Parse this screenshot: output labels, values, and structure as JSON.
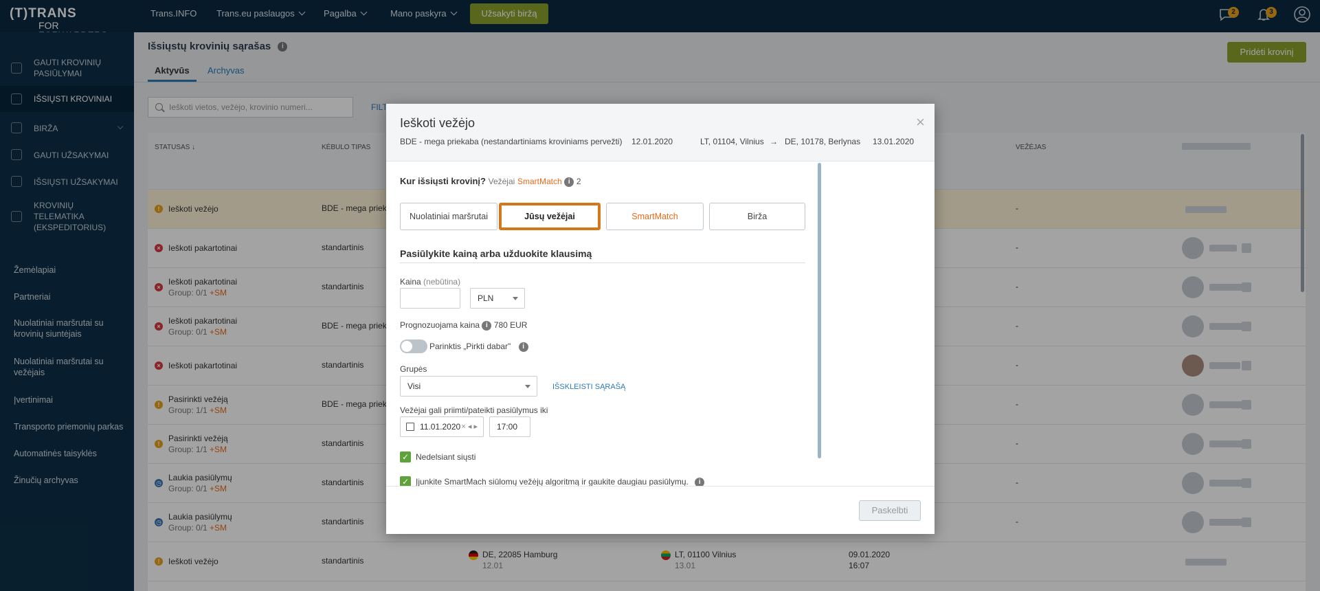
{
  "topbar": {
    "logo_line1": "(T)TRANS",
    "logo_line2": "FOR FORWARDERS",
    "nav": [
      {
        "label": "Trans.INFO"
      },
      {
        "label": "Trans.eu paslaugos"
      },
      {
        "label": "Pagalba"
      },
      {
        "label": "Mano paskyra"
      }
    ],
    "order_button": "Užsakyti biržą",
    "messages_badge": "2",
    "notifications_badge": "3"
  },
  "sidebar": {
    "main_items": [
      {
        "label": "GAUTI KROVINIŲ PASIŪLYMAI",
        "icon": "box-hand-icon"
      },
      {
        "label": "IŠSIŲSTI KROVINIAI",
        "icon": "dolly-icon"
      },
      {
        "label": "BIRŽA",
        "icon": "cube-icon"
      },
      {
        "label": "GAUTI UŽSAKYMAI",
        "icon": "grid-icon"
      },
      {
        "label": "IŠSIŲSTI UŽSAKYMAI",
        "icon": "handshake-icon"
      },
      {
        "label": "KROVINIŲ TELEMATIKA (EKSPEDITORIUS)",
        "icon": "satellite-icon"
      }
    ],
    "sub_items": [
      {
        "label": "Žemėlapiai"
      },
      {
        "label": "Partneriai"
      },
      {
        "label": "Nuolatiniai maršrutai su krovinių siuntėjais"
      },
      {
        "label": "Nuolatiniai maršrutai su vežėjais"
      },
      {
        "label": "Įvertinimai"
      },
      {
        "label": "Transporto priemonių parkas"
      },
      {
        "label": "Automatinės taisyklės"
      },
      {
        "label": "Žinučių archyvas"
      }
    ]
  },
  "page": {
    "title": "Išsiųstų krovinių sąrašas",
    "info_glyph": "i",
    "tab_active": "Aktyvūs",
    "tab_archive": "Archyvas",
    "add_button": "Pridėti krovinį",
    "search_placeholder": "Ieškoti vietos, vežėjo, krovinio numeri...",
    "filter_label": "FILT"
  },
  "table": {
    "headers": {
      "status": "STATUSAS ↓",
      "body": "KĖBULO TIPAS",
      "carrier": "VEŽĖJAS"
    },
    "rows": [
      {
        "status": "Ieškoti vežėjo",
        "group": "",
        "sm": "",
        "body": "BDE - mega priek",
        "carrier": "-",
        "status_color": "#e8a21a",
        "glyph": "!"
      },
      {
        "status": "Ieškoti pakartotinai",
        "group": "",
        "sm": "",
        "body": "standartinis",
        "carrier": "-",
        "status_color": "#d9393f",
        "glyph": "×"
      },
      {
        "status": "Ieškoti pakartotinai",
        "group": "Group: 0/1",
        "sm": "+SM",
        "body": "standartinis",
        "carrier": "-",
        "status_color": "#d9393f",
        "glyph": "×"
      },
      {
        "status": "Ieškoti pakartotinai",
        "group": "Group: 0/1",
        "sm": "+SM",
        "body": "BDE - mega priek",
        "carrier": "-",
        "status_color": "#d9393f",
        "glyph": "×"
      },
      {
        "status": "Ieškoti pakartotinai",
        "group": "",
        "sm": "",
        "body": "standartinis",
        "carrier": "-",
        "status_color": "#d9393f",
        "glyph": "×"
      },
      {
        "status": "Pasirinkti vežėją",
        "group": "Group: 1/1",
        "sm": "+SM",
        "body": "BDE - mega priek",
        "carrier": "-",
        "status_color": "#e8a21a",
        "glyph": "!"
      },
      {
        "status": "Pasirinkti vežėją",
        "group": "Group: 1/1",
        "sm": "+SM",
        "body": "standartinis",
        "carrier": "-",
        "status_color": "#e8a21a",
        "glyph": "!"
      },
      {
        "status": "Laukia pasiūlymų",
        "group": "Group: 0/1",
        "sm": "+SM",
        "body": "standartinis",
        "carrier": "-",
        "status_color": "#3a78b8",
        "glyph": "◷"
      },
      {
        "status": "Laukia pasiūlymų",
        "group": "Group: 0/1",
        "sm": "+SM",
        "body": "standartinis",
        "carrier": "-",
        "status_color": "#3a78b8",
        "glyph": "◷"
      },
      {
        "status": "Ieškoti vežėjo",
        "group": "",
        "sm": "",
        "body": "standartinis",
        "carrier": "",
        "status_color": "#e8a21a",
        "glyph": "!"
      }
    ],
    "last_row": {
      "from": "DE, 22085 Hamburg",
      "from_date": "12.01",
      "to": "LT, 01100 Vilnius",
      "to_date": "13.01",
      "pub_date": "09.01.2020",
      "pub_time": "16:07"
    }
  },
  "modal": {
    "title": "Ieškoti vežėjo",
    "close": "×",
    "route": {
      "body": "BDE - mega priekaba (nestandartiniams kroviniams pervežti)",
      "load_date": "12.01.2020",
      "from": "LT, 01104, Vilnius",
      "arrow": "→",
      "to": "DE, 10178, Berlynas",
      "unload_date": "13.01.2020"
    },
    "where_title": "Kur išsiųsti krovinį?",
    "where_hint_prefix": "Vežėjai",
    "where_hint_sm": "SmartMatch",
    "where_hint_count": "2",
    "segments": [
      "Nuolatiniai maršrutai",
      "Jūsų vežėjai",
      "SmartMatch",
      "Birža"
    ],
    "offer_title": "Pasiūlykite kainą arba užduokite klausimą",
    "price_label": "Kaina",
    "price_optional": "(nebūtina)",
    "price_value": "",
    "currency": "PLN",
    "forecast_label": "Prognozuojama kaina",
    "forecast_value": "780 EUR",
    "buy_now_label": "Parinktis „Pirkti dabar\"",
    "groups_label": "Grupės",
    "groups_value": "Visi",
    "expand_list": "IŠSKLEISTI SĄRAŠĄ",
    "deadline_label": "Vežėjai gali priimti/pateikti pasiūlymus iki",
    "deadline_date": "11.01.2020",
    "deadline_time": "17:00",
    "send_now_label": "Nedelsiant siųsti",
    "smartmatch_label": "Įjunkite SmartMach siūlomų vežėjų algoritmą ir gaukite daugiau pasiūlymų.",
    "publish_button": "Paskelbti"
  }
}
